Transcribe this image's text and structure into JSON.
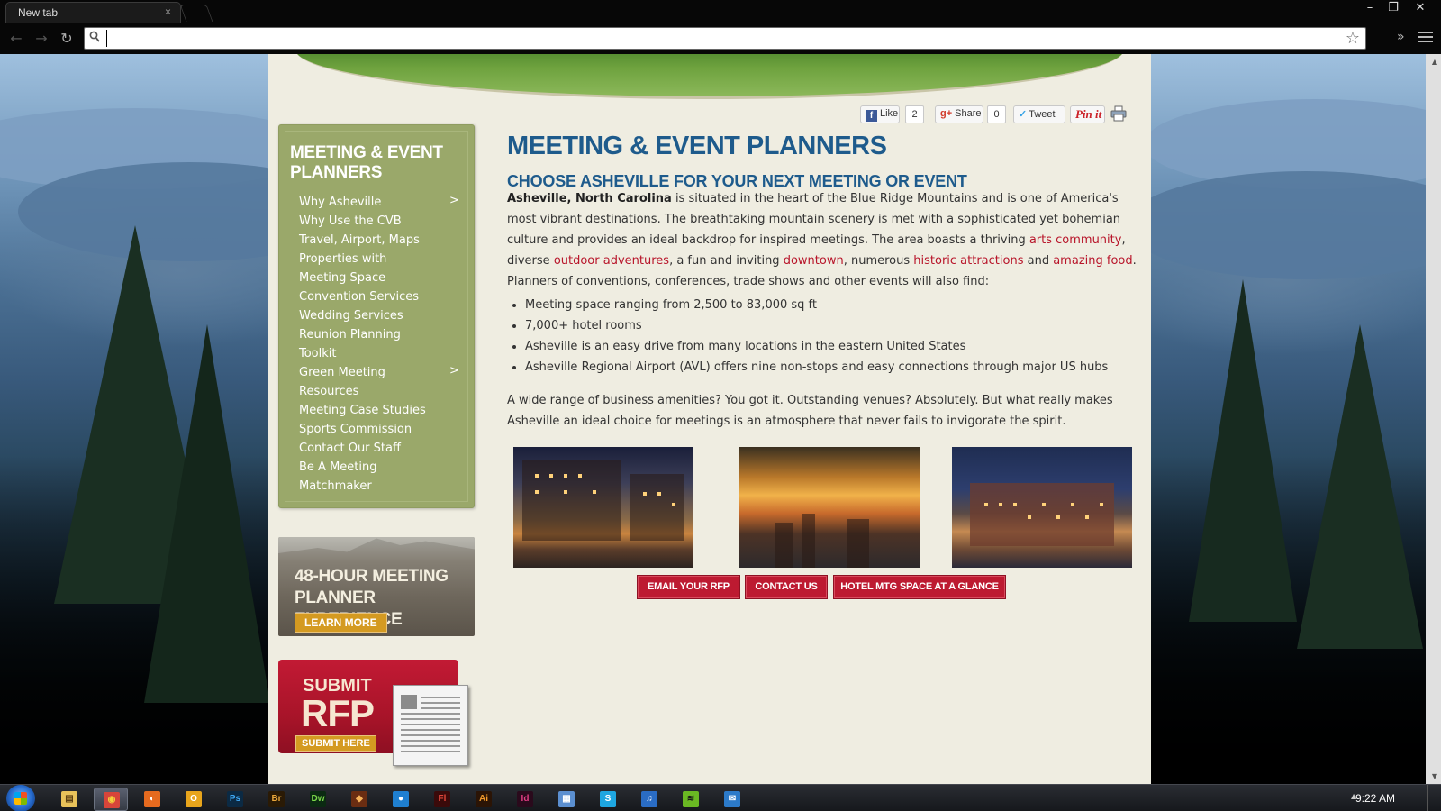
{
  "browser": {
    "tab_title": "New tab",
    "tab_close": "×",
    "omnibox_value": "",
    "omnibox_placeholder": "",
    "window_controls": {
      "minimize": "–",
      "restore": "❐",
      "close": "✕"
    },
    "nav": {
      "back": "←",
      "forward": "→",
      "reload": "↻"
    },
    "extensions_chevron": "»"
  },
  "share_bar": {
    "fb_label": "Like",
    "fb_count": "2",
    "gplus_label": "Share",
    "gplus_count": "0",
    "tweet_label": "Tweet",
    "pin_label": "Pin it"
  },
  "sidebar": {
    "heading": "MEETING & EVENT PLANNERS",
    "items": [
      {
        "label": "Why Asheville",
        "has_submenu": true
      },
      {
        "label": "Why Use the CVB"
      },
      {
        "label": "Travel, Airport, Maps"
      },
      {
        "label": "Properties with"
      },
      {
        "label": "Meeting Space"
      },
      {
        "label": "Convention Services"
      },
      {
        "label": "Wedding Services"
      },
      {
        "label": "Reunion Planning"
      },
      {
        "label": "Toolkit"
      },
      {
        "label": "Green Meeting",
        "has_submenu": true
      },
      {
        "label": "Resources"
      },
      {
        "label": "Meeting Case Studies"
      },
      {
        "label": "Sports Commission"
      },
      {
        "label": "Contact Our Staff"
      },
      {
        "label": "Be A Meeting"
      },
      {
        "label": "Matchmaker"
      }
    ],
    "submenu_arrow": ">"
  },
  "promo_48": {
    "title": "48-HOUR MEETING PLANNER EXPERIENCE",
    "button": "LEARN MORE"
  },
  "promo_rfp": {
    "line1": "SUBMIT",
    "line2": "RFP",
    "button": "SUBMIT HERE"
  },
  "main": {
    "title": "MEETING & EVENT PLANNERS",
    "subtitle": "CHOOSE ASHEVILLE FOR YOUR NEXT MEETING OR EVENT",
    "intro": {
      "bold": "Asheville, North Carolina",
      "t1": " is situated in the heart of the Blue Ridge Mountains and is one of America's most vibrant destinations. The breathtaking mountain scenery is met with a sophisticated yet bohemian culture and provides an ideal backdrop for inspired meetings. The area boasts a thriving ",
      "link1": "arts community",
      "t2": ", diverse ",
      "link2": "outdoor adventures",
      "t3": ", a fun and inviting ",
      "link3": "downtown",
      "t4": ", numerous ",
      "link4": "historic attractions",
      "t5": " and ",
      "link5": "amazing food",
      "t6": ". Planners of conventions, conferences, trade shows and other events will also find:"
    },
    "bullets": [
      "Meeting space ranging from 2,500 to 83,000 sq ft",
      "7,000+ hotel rooms",
      "Asheville is an easy drive from many locations in the eastern United States",
      "Asheville Regional Airport (AVL) offers nine non-stops and easy connections through major US hubs"
    ],
    "closing": "A wide range of business amenities? You got it. Outstanding venues? Absolutely. But what really makes Asheville an ideal choice for meetings is an atmosphere that never fails to invigorate the spirit.",
    "cta": {
      "email_rfp": "EMAIL YOUR RFP",
      "contact": "CONTACT US",
      "hotel_space": "HOTEL MTG SPACE AT A GLANCE"
    }
  },
  "taskbar": {
    "clock": "9:22 AM",
    "apps": [
      {
        "name": "explorer",
        "glyph": "▤",
        "color": "#e8c25a",
        "fg": "#5a3d10"
      },
      {
        "name": "chrome",
        "glyph": "◉",
        "color": "#d8453a",
        "fg": "#f5d33c",
        "active": true
      },
      {
        "name": "firefox",
        "glyph": "◐",
        "color": "#e56a1f",
        "fg": "#fff"
      },
      {
        "name": "outlook",
        "glyph": "O",
        "color": "#e8a51c",
        "fg": "#fff"
      },
      {
        "name": "photoshop",
        "glyph": "Ps",
        "color": "#0b2a44",
        "fg": "#3fa9f5"
      },
      {
        "name": "bridge",
        "glyph": "Br",
        "color": "#2a1a05",
        "fg": "#e6a43a"
      },
      {
        "name": "dreamweaver",
        "glyph": "Dw",
        "color": "#0b2a12",
        "fg": "#7bd84a"
      },
      {
        "name": "fireworks-app",
        "glyph": "◆",
        "color": "#6a2d12",
        "fg": "#f4b25a"
      },
      {
        "name": "skype-blue",
        "glyph": "●",
        "color": "#1f7fd0",
        "fg": "#fff"
      },
      {
        "name": "flash",
        "glyph": "Fl",
        "color": "#3a0a0a",
        "fg": "#e2463a"
      },
      {
        "name": "illustrator",
        "glyph": "Ai",
        "color": "#2b1405",
        "fg": "#f39a2a"
      },
      {
        "name": "indesign",
        "glyph": "Id",
        "color": "#2a0a1c",
        "fg": "#e23d84"
      },
      {
        "name": "notepad",
        "glyph": "▦",
        "color": "#5b8fd0",
        "fg": "#fff"
      },
      {
        "name": "skype",
        "glyph": "S",
        "color": "#1ea6e0",
        "fg": "#fff"
      },
      {
        "name": "itunes",
        "glyph": "♫",
        "color": "#2a6cc4",
        "fg": "#fff"
      },
      {
        "name": "spotify",
        "glyph": "≋",
        "color": "#6ab823",
        "fg": "#1a1a1a"
      },
      {
        "name": "outlook-app",
        "glyph": "✉",
        "color": "#2c7ac9",
        "fg": "#fff"
      }
    ]
  }
}
